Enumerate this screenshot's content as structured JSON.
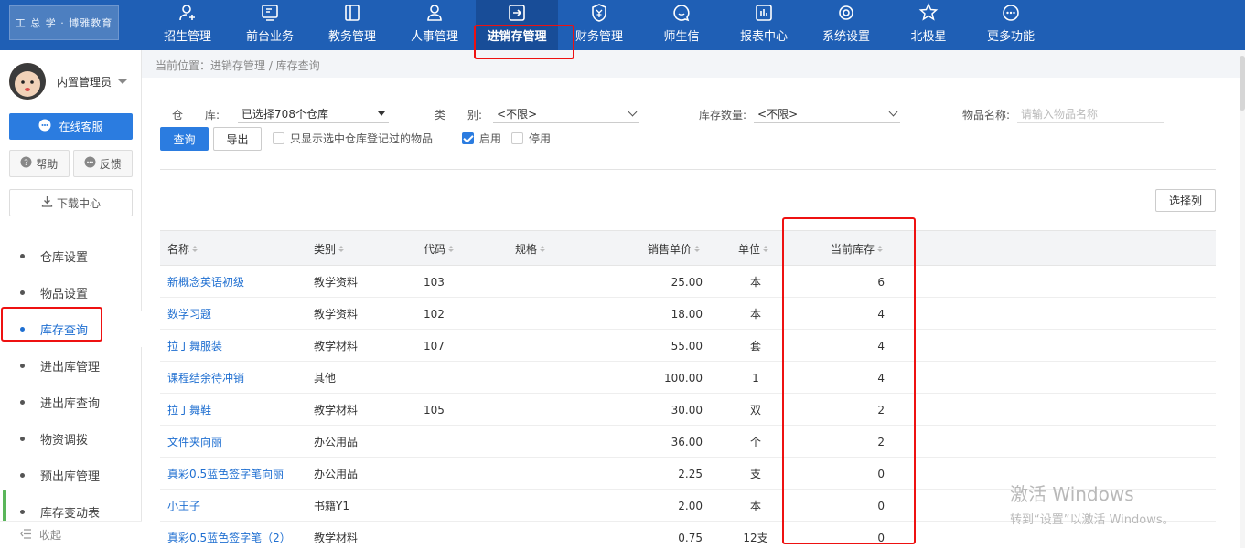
{
  "logo": {
    "text": "工 总 学 · 博雅教育"
  },
  "nav": {
    "items": [
      {
        "label": "招生管理",
        "icon": "user-add-icon"
      },
      {
        "label": "前台业务",
        "icon": "monitor-icon"
      },
      {
        "label": "教务管理",
        "icon": "book-icon"
      },
      {
        "label": "人事管理",
        "icon": "person-icon"
      },
      {
        "label": "进销存管理",
        "icon": "exit-box-icon"
      },
      {
        "label": "财务管理",
        "icon": "yen-shield-icon"
      },
      {
        "label": "师生信",
        "icon": "chat-bubble-icon"
      },
      {
        "label": "报表中心",
        "icon": "bar-report-icon"
      },
      {
        "label": "系统设置",
        "icon": "gear-icon"
      },
      {
        "label": "北极星",
        "icon": "star-icon"
      },
      {
        "label": "更多功能",
        "icon": "more-icon"
      }
    ],
    "active_index": 4
  },
  "user": {
    "name": "内置管理员"
  },
  "sidebar": {
    "kefu": "在线客服",
    "help": "帮助",
    "feedback": "反馈",
    "download": "下载中心",
    "collapse": "收起",
    "items": [
      {
        "label": "仓库设置"
      },
      {
        "label": "物品设置"
      },
      {
        "label": "库存查询"
      },
      {
        "label": "进出库管理"
      },
      {
        "label": "进出库查询"
      },
      {
        "label": "物资调拨"
      },
      {
        "label": "预出库管理"
      },
      {
        "label": "库存变动表"
      }
    ],
    "active_index": 2
  },
  "breadcrumb": "当前位置：进销存管理 / 库存查询",
  "filters": {
    "warehouse_label": "仓　　库:",
    "warehouse_value": "已选择708个仓库",
    "category_label": "类　　别:",
    "category_value": "<不限>",
    "stock_label": "库存数量:",
    "stock_value": "<不限>",
    "name_label": "物品名称:",
    "name_placeholder": "请输入物品名称"
  },
  "actions": {
    "query": "查询",
    "export": "导出",
    "only_registered": "只显示选中仓库登记过的物品",
    "enabled": "启用",
    "disabled": "停用",
    "select_columns": "选择列"
  },
  "checks": {
    "only_registered": false,
    "enabled": true,
    "disabled": false
  },
  "table": {
    "headers": [
      "名称",
      "类别",
      "代码",
      "规格",
      "销售单价",
      "单位",
      "当前库存"
    ],
    "rows": [
      {
        "name": "新概念英语初级",
        "category": "教学资料",
        "code": "103",
        "spec": "",
        "price": "25.00",
        "unit": "本",
        "stock": "6"
      },
      {
        "name": "数学习题",
        "category": "教学资料",
        "code": "102",
        "spec": "",
        "price": "18.00",
        "unit": "本",
        "stock": "4"
      },
      {
        "name": "拉丁舞服装",
        "category": "教学材料",
        "code": "107",
        "spec": "",
        "price": "55.00",
        "unit": "套",
        "stock": "4"
      },
      {
        "name": "课程结余待冲销",
        "category": "其他",
        "code": "",
        "spec": "",
        "price": "100.00",
        "unit": "1",
        "stock": "4"
      },
      {
        "name": "拉丁舞鞋",
        "category": "教学材料",
        "code": "105",
        "spec": "",
        "price": "30.00",
        "unit": "双",
        "stock": "2"
      },
      {
        "name": "文件夹向丽",
        "category": "办公用品",
        "code": "",
        "spec": "",
        "price": "36.00",
        "unit": "个",
        "stock": "2"
      },
      {
        "name": "真彩0.5蓝色签字笔向丽",
        "category": "办公用品",
        "code": "",
        "spec": "",
        "price": "2.25",
        "unit": "支",
        "stock": "0"
      },
      {
        "name": "小王子",
        "category": "书籍Y1",
        "code": "",
        "spec": "",
        "price": "2.00",
        "unit": "本",
        "stock": "0"
      },
      {
        "name": "真彩0.5蓝色签字笔（2）",
        "category": "教学材料",
        "code": "",
        "spec": "",
        "price": "0.75",
        "unit": "12支",
        "stock": "0"
      }
    ]
  },
  "watermark": {
    "line1": "激活 Windows",
    "line2": "转到“设置”以激活 Windows。"
  },
  "colors": {
    "topbar": "#1f5fb5",
    "accent": "#2b7ce0",
    "link": "#1f6fd1",
    "highlight": "#e11111"
  }
}
